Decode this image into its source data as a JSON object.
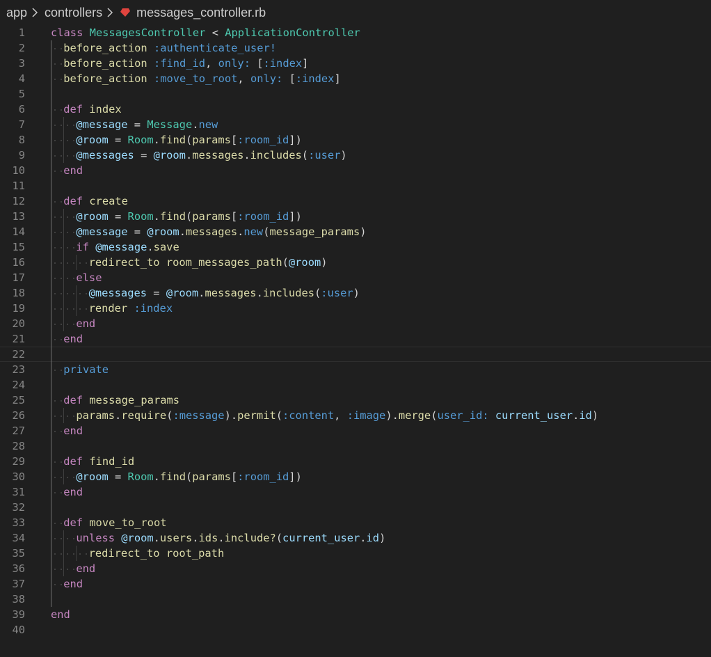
{
  "breadcrumb": {
    "items": [
      "app",
      "controllers"
    ],
    "file": "messages_controller.rb"
  },
  "colors": {
    "background": "#1f1f1f",
    "keyword": "#c586c0",
    "class": "#4ec9b0",
    "method": "#dcdcaa",
    "symbol": "#569cd6",
    "variable": "#9cdcfe",
    "plain": "#d4d4d4",
    "line_number": "#858585",
    "ruby_icon": "#e0443e"
  },
  "editor": {
    "language": "ruby",
    "cursor_line": 22,
    "lines": [
      {
        "n": "1",
        "indent": 0,
        "tokens": [
          [
            "keyword",
            "class"
          ],
          [
            "plain",
            " "
          ],
          [
            "class",
            "MessagesController"
          ],
          [
            "plain",
            " < "
          ],
          [
            "class",
            "ApplicationController"
          ]
        ]
      },
      {
        "n": "2",
        "indent": 1,
        "tokens": [
          [
            "method",
            "before_action"
          ],
          [
            "plain",
            " "
          ],
          [
            "symbol",
            ":authenticate_user!"
          ]
        ]
      },
      {
        "n": "3",
        "indent": 1,
        "tokens": [
          [
            "method",
            "before_action"
          ],
          [
            "plain",
            " "
          ],
          [
            "symbol",
            ":find_id"
          ],
          [
            "plain",
            ", "
          ],
          [
            "symbol",
            "only:"
          ],
          [
            "plain",
            " ["
          ],
          [
            "symbol",
            ":index"
          ],
          [
            "plain",
            "]"
          ]
        ]
      },
      {
        "n": "4",
        "indent": 1,
        "tokens": [
          [
            "method",
            "before_action"
          ],
          [
            "plain",
            " "
          ],
          [
            "symbol",
            ":move_to_root"
          ],
          [
            "plain",
            ", "
          ],
          [
            "symbol",
            "only:"
          ],
          [
            "plain",
            " ["
          ],
          [
            "symbol",
            ":index"
          ],
          [
            "plain",
            "]"
          ]
        ]
      },
      {
        "n": "5",
        "indent": 0,
        "tokens": []
      },
      {
        "n": "6",
        "indent": 1,
        "tokens": [
          [
            "keyword",
            "def"
          ],
          [
            "plain",
            " "
          ],
          [
            "method",
            "index"
          ]
        ]
      },
      {
        "n": "7",
        "indent": 2,
        "tokens": [
          [
            "ivar",
            "@message"
          ],
          [
            "plain",
            " = "
          ],
          [
            "class",
            "Message"
          ],
          [
            "plain",
            "."
          ],
          [
            "symbol",
            "new"
          ]
        ]
      },
      {
        "n": "8",
        "indent": 2,
        "tokens": [
          [
            "ivar",
            "@room"
          ],
          [
            "plain",
            " = "
          ],
          [
            "class",
            "Room"
          ],
          [
            "plain",
            "."
          ],
          [
            "method",
            "find"
          ],
          [
            "plain",
            "("
          ],
          [
            "method",
            "params"
          ],
          [
            "plain",
            "["
          ],
          [
            "symbol",
            ":room_id"
          ],
          [
            "plain",
            "])"
          ]
        ]
      },
      {
        "n": "9",
        "indent": 2,
        "tokens": [
          [
            "ivar",
            "@messages"
          ],
          [
            "plain",
            " = "
          ],
          [
            "ivar",
            "@room"
          ],
          [
            "plain",
            "."
          ],
          [
            "method",
            "messages"
          ],
          [
            "plain",
            "."
          ],
          [
            "method",
            "includes"
          ],
          [
            "plain",
            "("
          ],
          [
            "symbol",
            ":user"
          ],
          [
            "plain",
            ")"
          ]
        ]
      },
      {
        "n": "10",
        "indent": 1,
        "tokens": [
          [
            "keyword",
            "end"
          ]
        ]
      },
      {
        "n": "11",
        "indent": 0,
        "tokens": []
      },
      {
        "n": "12",
        "indent": 1,
        "tokens": [
          [
            "keyword",
            "def"
          ],
          [
            "plain",
            " "
          ],
          [
            "method",
            "create"
          ]
        ]
      },
      {
        "n": "13",
        "indent": 2,
        "tokens": [
          [
            "ivar",
            "@room"
          ],
          [
            "plain",
            " = "
          ],
          [
            "class",
            "Room"
          ],
          [
            "plain",
            "."
          ],
          [
            "method",
            "find"
          ],
          [
            "plain",
            "("
          ],
          [
            "method",
            "params"
          ],
          [
            "plain",
            "["
          ],
          [
            "symbol",
            ":room_id"
          ],
          [
            "plain",
            "])"
          ]
        ]
      },
      {
        "n": "14",
        "indent": 2,
        "tokens": [
          [
            "ivar",
            "@message"
          ],
          [
            "plain",
            " = "
          ],
          [
            "ivar",
            "@room"
          ],
          [
            "plain",
            "."
          ],
          [
            "method",
            "messages"
          ],
          [
            "plain",
            "."
          ],
          [
            "symbol",
            "new"
          ],
          [
            "plain",
            "("
          ],
          [
            "method",
            "message_params"
          ],
          [
            "plain",
            ")"
          ]
        ]
      },
      {
        "n": "15",
        "indent": 2,
        "tokens": [
          [
            "keyword",
            "if"
          ],
          [
            "plain",
            " "
          ],
          [
            "ivar",
            "@message"
          ],
          [
            "plain",
            "."
          ],
          [
            "method",
            "save"
          ]
        ]
      },
      {
        "n": "16",
        "indent": 3,
        "tokens": [
          [
            "method",
            "redirect_to"
          ],
          [
            "plain",
            " "
          ],
          [
            "method",
            "room_messages_path"
          ],
          [
            "plain",
            "("
          ],
          [
            "ivar",
            "@room"
          ],
          [
            "plain",
            ")"
          ]
        ]
      },
      {
        "n": "17",
        "indent": 2,
        "tokens": [
          [
            "keyword",
            "else"
          ]
        ]
      },
      {
        "n": "18",
        "indent": 3,
        "tokens": [
          [
            "ivar",
            "@messages"
          ],
          [
            "plain",
            " = "
          ],
          [
            "ivar",
            "@room"
          ],
          [
            "plain",
            "."
          ],
          [
            "method",
            "messages"
          ],
          [
            "plain",
            "."
          ],
          [
            "method",
            "includes"
          ],
          [
            "plain",
            "("
          ],
          [
            "symbol",
            ":user"
          ],
          [
            "plain",
            ")"
          ]
        ]
      },
      {
        "n": "19",
        "indent": 3,
        "tokens": [
          [
            "method",
            "render"
          ],
          [
            "plain",
            " "
          ],
          [
            "symbol",
            ":index"
          ]
        ]
      },
      {
        "n": "20",
        "indent": 2,
        "tokens": [
          [
            "keyword",
            "end"
          ]
        ]
      },
      {
        "n": "21",
        "indent": 1,
        "tokens": [
          [
            "keyword",
            "end"
          ]
        ]
      },
      {
        "n": "22",
        "indent": 0,
        "tokens": []
      },
      {
        "n": "23",
        "indent": 1,
        "tokens": [
          [
            "symbol",
            "private"
          ]
        ]
      },
      {
        "n": "24",
        "indent": 0,
        "tokens": []
      },
      {
        "n": "25",
        "indent": 1,
        "tokens": [
          [
            "keyword",
            "def"
          ],
          [
            "plain",
            " "
          ],
          [
            "method",
            "message_params"
          ]
        ]
      },
      {
        "n": "26",
        "indent": 2,
        "tokens": [
          [
            "method",
            "params"
          ],
          [
            "plain",
            "."
          ],
          [
            "method",
            "require"
          ],
          [
            "plain",
            "("
          ],
          [
            "symbol",
            ":message"
          ],
          [
            "plain",
            ")."
          ],
          [
            "method",
            "permit"
          ],
          [
            "plain",
            "("
          ],
          [
            "symbol",
            ":content"
          ],
          [
            "plain",
            ", "
          ],
          [
            "symbol",
            ":image"
          ],
          [
            "plain",
            ")."
          ],
          [
            "method",
            "merge"
          ],
          [
            "plain",
            "("
          ],
          [
            "symbol",
            "user_id:"
          ],
          [
            "plain",
            " "
          ],
          [
            "var",
            "current_user"
          ],
          [
            "plain",
            "."
          ],
          [
            "var",
            "id"
          ],
          [
            "plain",
            ")"
          ]
        ]
      },
      {
        "n": "27",
        "indent": 1,
        "tokens": [
          [
            "keyword",
            "end"
          ]
        ]
      },
      {
        "n": "28",
        "indent": 0,
        "tokens": []
      },
      {
        "n": "29",
        "indent": 1,
        "tokens": [
          [
            "keyword",
            "def"
          ],
          [
            "plain",
            " "
          ],
          [
            "method",
            "find_id"
          ]
        ]
      },
      {
        "n": "30",
        "indent": 2,
        "tokens": [
          [
            "ivar",
            "@room"
          ],
          [
            "plain",
            " = "
          ],
          [
            "class",
            "Room"
          ],
          [
            "plain",
            "."
          ],
          [
            "method",
            "find"
          ],
          [
            "plain",
            "("
          ],
          [
            "method",
            "params"
          ],
          [
            "plain",
            "["
          ],
          [
            "symbol",
            ":room_id"
          ],
          [
            "plain",
            "])"
          ]
        ]
      },
      {
        "n": "31",
        "indent": 1,
        "tokens": [
          [
            "keyword",
            "end"
          ]
        ]
      },
      {
        "n": "32",
        "indent": 0,
        "tokens": []
      },
      {
        "n": "33",
        "indent": 1,
        "tokens": [
          [
            "keyword",
            "def"
          ],
          [
            "plain",
            " "
          ],
          [
            "method",
            "move_to_root"
          ]
        ]
      },
      {
        "n": "34",
        "indent": 2,
        "tokens": [
          [
            "keyword",
            "unless"
          ],
          [
            "plain",
            " "
          ],
          [
            "ivar",
            "@room"
          ],
          [
            "plain",
            "."
          ],
          [
            "method",
            "users"
          ],
          [
            "plain",
            "."
          ],
          [
            "method",
            "ids"
          ],
          [
            "plain",
            "."
          ],
          [
            "method",
            "include?"
          ],
          [
            "plain",
            "("
          ],
          [
            "var",
            "current_user"
          ],
          [
            "plain",
            "."
          ],
          [
            "var",
            "id"
          ],
          [
            "plain",
            ")"
          ]
        ]
      },
      {
        "n": "35",
        "indent": 3,
        "tokens": [
          [
            "method",
            "redirect_to"
          ],
          [
            "plain",
            " "
          ],
          [
            "method",
            "root_path"
          ]
        ]
      },
      {
        "n": "36",
        "indent": 2,
        "tokens": [
          [
            "keyword",
            "end"
          ]
        ]
      },
      {
        "n": "37",
        "indent": 1,
        "tokens": [
          [
            "keyword",
            "end"
          ]
        ]
      },
      {
        "n": "38",
        "indent": 0,
        "tokens": []
      },
      {
        "n": "39",
        "indent": 0,
        "tokens": [
          [
            "keyword",
            "end"
          ]
        ]
      },
      {
        "n": "40",
        "indent": 0,
        "tokens": []
      }
    ]
  }
}
